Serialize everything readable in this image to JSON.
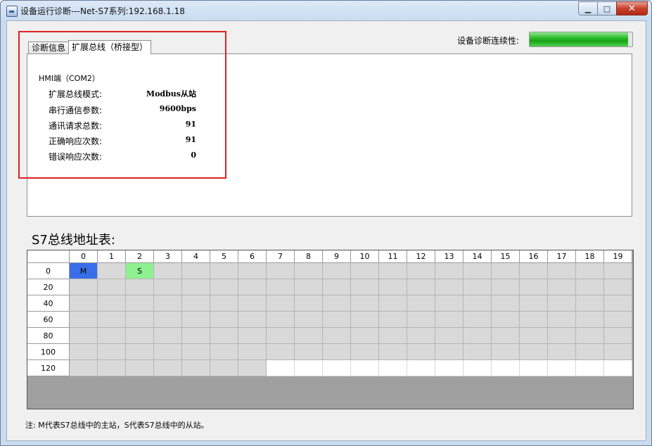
{
  "window": {
    "title": "设备运行诊断---Net-S7系列:192.168.1.18",
    "min_symbol": "▁",
    "max_symbol": "□",
    "close_symbol": "✕"
  },
  "tabs": [
    {
      "label": "诊断信息",
      "active": false
    },
    {
      "label": "扩展总线（桥接型）",
      "active": true
    }
  ],
  "panel": {
    "title": "HMI端（COM2）",
    "rows": [
      {
        "label": "扩展总线模式:",
        "value": "Modbus从站"
      },
      {
        "label": "串行通信参数:",
        "value": "9600bps"
      },
      {
        "label": "通讯请求总数:",
        "value": "91"
      },
      {
        "label": "正确响应次数:",
        "value": "91"
      },
      {
        "label": "错误响应次数:",
        "value": "0"
      }
    ]
  },
  "connectivity": {
    "label": "设备诊断连续性:",
    "fraction": 0.96,
    "color": "#2bbd2b"
  },
  "address_table": {
    "title": "S7总线地址表:",
    "columns": [
      "0",
      "1",
      "2",
      "3",
      "4",
      "5",
      "6",
      "7",
      "8",
      "9",
      "10",
      "11",
      "12",
      "13",
      "14",
      "15",
      "16",
      "17",
      "18",
      "19"
    ],
    "rows": [
      "0",
      "20",
      "40",
      "60",
      "80",
      "100",
      "120"
    ],
    "marks": [
      {
        "row": 0,
        "col": 0,
        "text": "M",
        "color": "#3a6ee8"
      },
      {
        "row": 0,
        "col": 2,
        "text": "S",
        "color": "#8ff08f"
      }
    ],
    "last_row_filled_cols": 7
  },
  "note": "注: M代表S7总线中的主站，S代表S7总线中的从站。"
}
